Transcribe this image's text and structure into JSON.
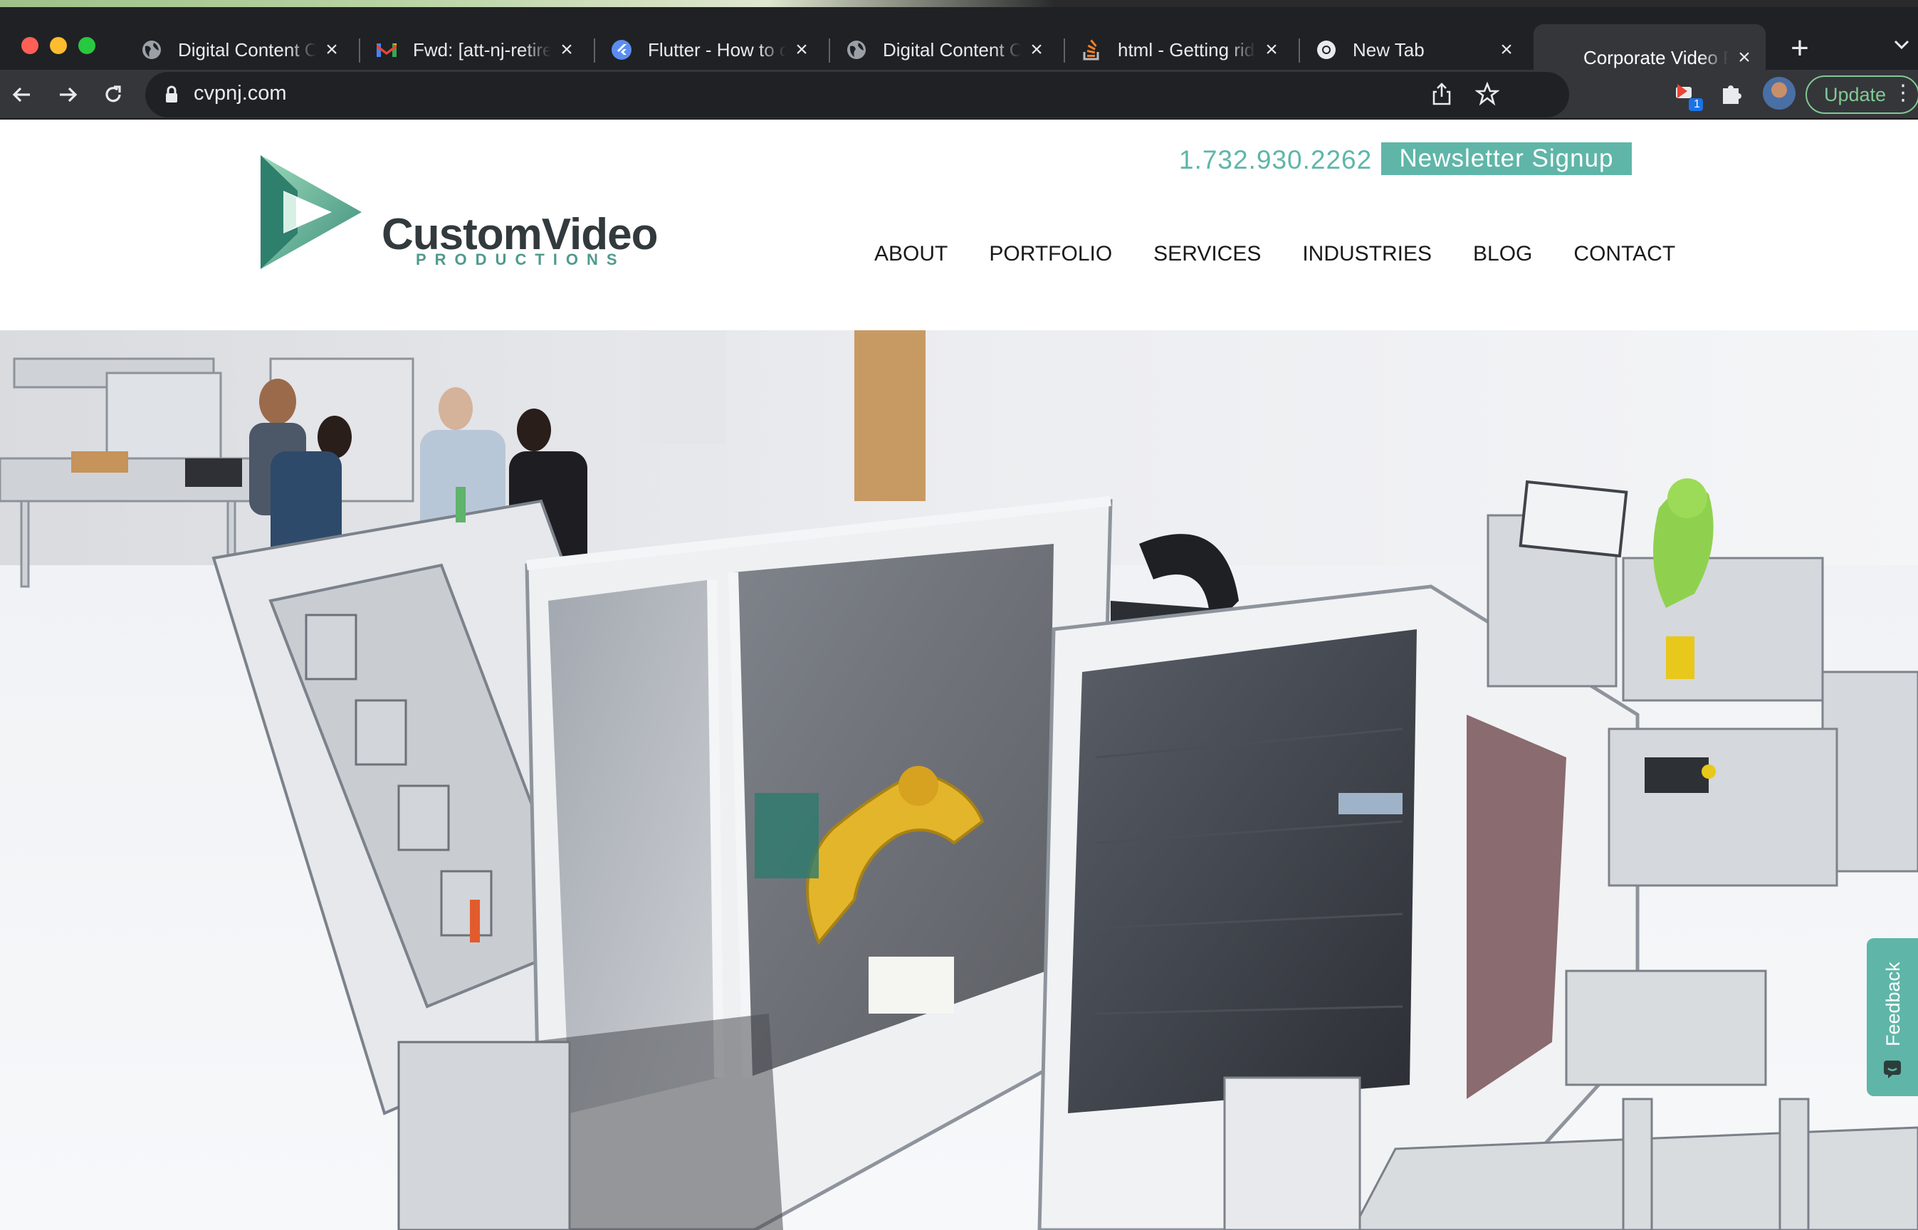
{
  "browser": {
    "tabs": [
      {
        "title": "Digital Content Cr",
        "icon": "globe-icon"
      },
      {
        "title": "Fwd: [att-nj-retire",
        "icon": "gmail-icon"
      },
      {
        "title": "Flutter - How to c",
        "icon": "flutter-icon"
      },
      {
        "title": "Digital Content Cr",
        "icon": "globe-icon"
      },
      {
        "title": "html - Getting rid",
        "icon": "stackoverflow-icon"
      },
      {
        "title": "New Tab",
        "icon": "chrome-icon"
      },
      {
        "title": "Corporate Video P",
        "icon": "none",
        "active": true
      }
    ],
    "url": "cvpnj.com",
    "update_label": "Update",
    "extension_badge": "1"
  },
  "site": {
    "logo": {
      "wordmark": "CustomVideo",
      "subtitle": "PRODUCTIONS"
    },
    "phone": "1.732.930.2262",
    "newsletter_label": "Newsletter Signup",
    "nav": [
      "ABOUT",
      "PORTFOLIO",
      "SERVICES",
      "INDUSTRIES",
      "BLOG",
      "CONTACT"
    ],
    "feedback_label": "Feedback"
  },
  "colors": {
    "brand_teal": "#5fb6a8",
    "chrome_dark": "#202124",
    "chrome_toolbar": "#35363a"
  }
}
